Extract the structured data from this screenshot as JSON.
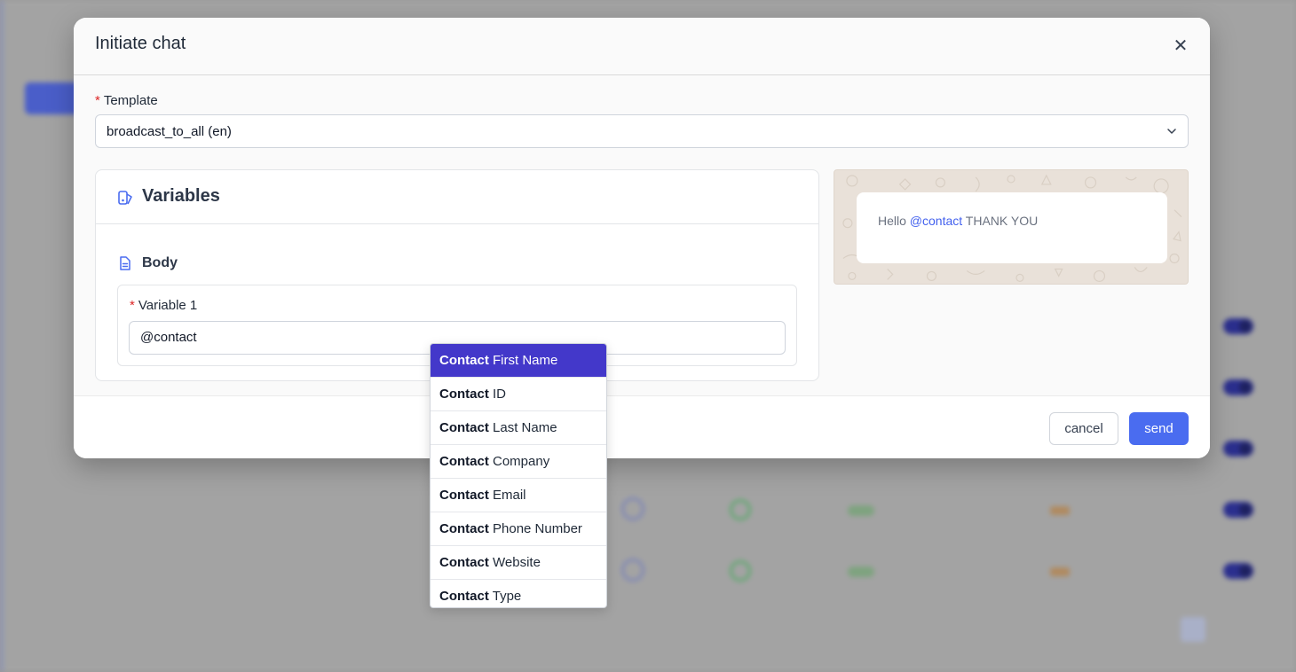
{
  "modal": {
    "title": "Initiate chat",
    "close_icon": "close-icon"
  },
  "template": {
    "label": "Template",
    "required_mark": "*",
    "selected": "broadcast_to_all (en)"
  },
  "variables": {
    "title": "Variables",
    "body_title": "Body",
    "variable_1_label": "Variable 1",
    "variable_1_value": "@contact"
  },
  "preview": {
    "prefix": "Hello ",
    "mention": "@contact",
    "suffix": " THANK YOU"
  },
  "footer": {
    "cancel_label": "cancel",
    "send_label": "send"
  },
  "dropdown": {
    "items": [
      {
        "bold": "Contact",
        "rest": " First Name"
      },
      {
        "bold": "Contact",
        "rest": " ID"
      },
      {
        "bold": "Contact",
        "rest": " Last Name"
      },
      {
        "bold": "Contact",
        "rest": " Company"
      },
      {
        "bold": "Contact",
        "rest": " Email"
      },
      {
        "bold": "Contact",
        "rest": " Phone Number"
      },
      {
        "bold": "Contact",
        "rest": " Website"
      },
      {
        "bold": "Contact",
        "rest": " Type"
      }
    ]
  },
  "colors": {
    "accent": "#4a6cf0",
    "dropdown_active": "#4338ca",
    "required": "#dc2626",
    "mention": "#4361ee"
  }
}
